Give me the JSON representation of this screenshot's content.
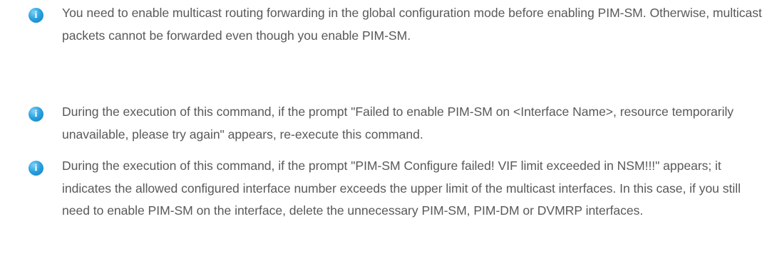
{
  "notes": [
    {
      "icon": "info-icon",
      "text": "You need to enable multicast routing forwarding in the global configuration mode before enabling PIM-SM. Otherwise, multicast packets cannot be forwarded even though you enable PIM-SM."
    },
    {
      "icon": "info-icon",
      "text": "During the execution of this command, if the prompt \"Failed to enable PIM-SM on <Interface Name>, resource temporarily unavailable, please try again\" appears, re-execute this command."
    },
    {
      "icon": "info-icon",
      "text": "During the execution of this command, if the prompt \"PIM-SM Configure failed! VIF limit exceeded in NSM!!!\" appears; it indicates the allowed configured interface number exceeds the upper limit of the multicast interfaces. In this case, if you still need to enable PIM-SM on the interface, delete the unnecessary PIM-SM, PIM-DM or DVMRP interfaces."
    }
  ],
  "colors": {
    "text": "#595959",
    "icon": "#2aa3e0"
  }
}
